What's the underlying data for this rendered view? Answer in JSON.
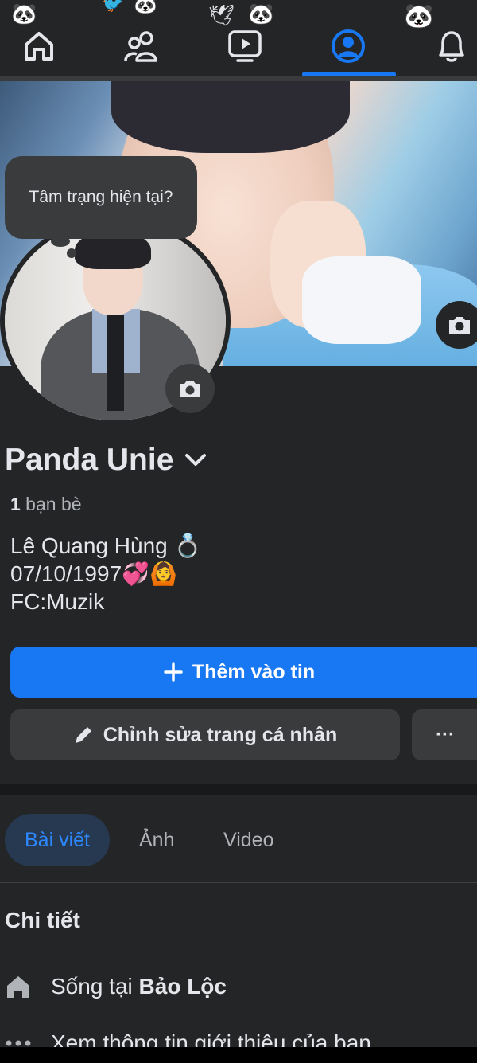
{
  "nav": {
    "items": [
      {
        "name": "home-icon"
      },
      {
        "name": "friends-icon"
      },
      {
        "name": "video-icon"
      },
      {
        "name": "profile-icon",
        "active": true
      },
      {
        "name": "notifications-bell-icon"
      }
    ],
    "accent": "#1877f2"
  },
  "mood_bubble": {
    "text": "Tâm trạng hiện tại?"
  },
  "profile": {
    "name": "Panda Unie",
    "friends_count": "1",
    "friends_label": " bạn bè",
    "bio": [
      "Lê Quang Hùng 💍",
      "07/10/1997💞🙆",
      "FC:Muzik"
    ]
  },
  "buttons": {
    "add_story": "Thêm vào tin",
    "edit_profile": "Chỉnh sửa trang cá nhân",
    "more": "···"
  },
  "tabs": [
    {
      "label": "Bài viết",
      "active": true
    },
    {
      "label": "Ảnh"
    },
    {
      "label": "Video"
    }
  ],
  "details": {
    "title": "Chi tiết",
    "lives_in_prefix": "Sống tại ",
    "lives_in_place": "Bảo Lộc",
    "see_about": "Xem thông tin giới thiệu của bạn"
  },
  "colors": {
    "background": "#242526",
    "button_primary": "#1877f2",
    "button_secondary": "#3a3b3c",
    "tab_active_bg": "#263951"
  }
}
